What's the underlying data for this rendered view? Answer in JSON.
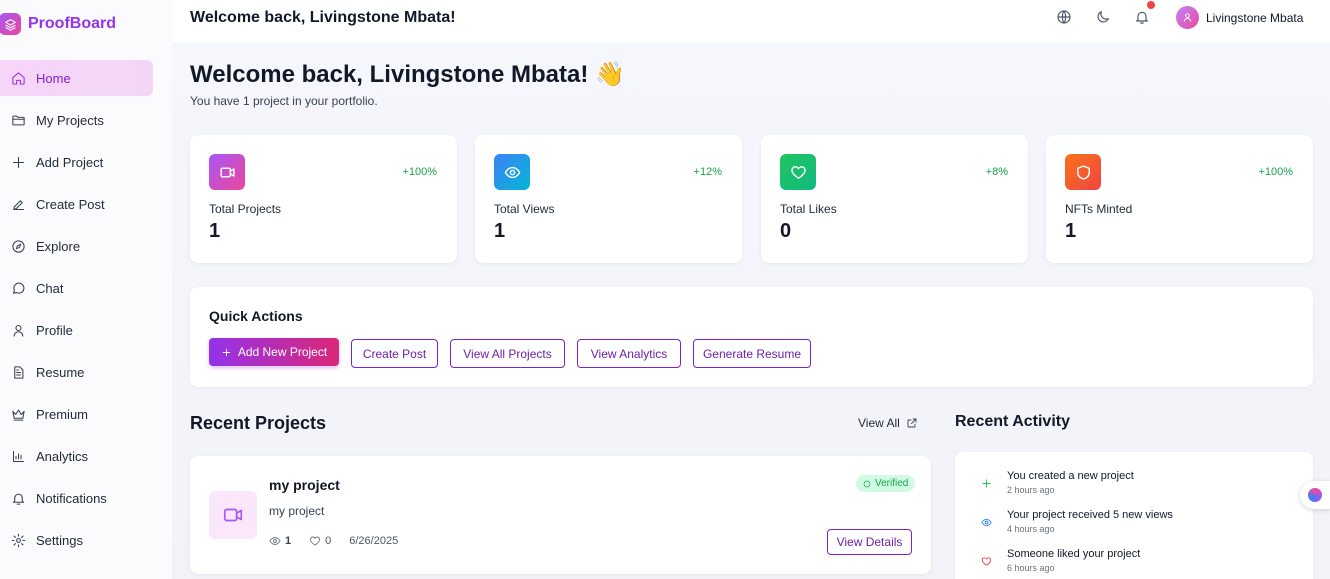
{
  "brand": {
    "name": "ProofBoard"
  },
  "sidebar": {
    "items": [
      {
        "label": "Home",
        "icon": "home-icon",
        "active": true
      },
      {
        "label": "My Projects",
        "icon": "folder-icon"
      },
      {
        "label": "Add Project",
        "icon": "plus-icon"
      },
      {
        "label": "Create Post",
        "icon": "pen-icon"
      },
      {
        "label": "Explore",
        "icon": "compass-icon"
      },
      {
        "label": "Chat",
        "icon": "chat-icon"
      },
      {
        "label": "Profile",
        "icon": "user-icon"
      },
      {
        "label": "Resume",
        "icon": "document-icon"
      },
      {
        "label": "Premium",
        "icon": "crown-icon"
      },
      {
        "label": "Analytics",
        "icon": "bar-chart-icon"
      },
      {
        "label": "Notifications",
        "icon": "bell-icon"
      },
      {
        "label": "Settings",
        "icon": "gear-icon"
      }
    ]
  },
  "topbar": {
    "title": "Welcome back, Livingstone Mbata!",
    "user_name": "Livingstone Mbata"
  },
  "main": {
    "greeting": "Welcome back, Livingstone Mbata! 👋",
    "subtitle": "You have 1 project in your portfolio."
  },
  "stats": [
    {
      "label": "Total Projects",
      "value": "1",
      "change": "+100%",
      "icon": "video-icon",
      "color": "#c026d3"
    },
    {
      "label": "Total Views",
      "value": "1",
      "change": "+12%",
      "icon": "eye-icon",
      "color": "#3b82f6"
    },
    {
      "label": "Total Likes",
      "value": "0",
      "change": "+8%",
      "icon": "heart-icon",
      "color": "#22c55e"
    },
    {
      "label": "NFTs Minted",
      "value": "1",
      "change": "+100%",
      "icon": "shield-icon",
      "color": "#f97316"
    }
  ],
  "quick_actions": {
    "title": "Quick Actions",
    "buttons": [
      "Add New Project",
      "Create Post",
      "View All Projects",
      "View Analytics",
      "Generate Resume"
    ]
  },
  "recent_projects": {
    "title": "Recent Projects",
    "view_all": "View All",
    "items": [
      {
        "title": "my project",
        "description": "my project",
        "views": "1",
        "likes": "0",
        "date": "6/26/2025",
        "badge": "Verified",
        "action": "View Details"
      }
    ]
  },
  "recent_activity": {
    "title": "Recent Activity",
    "items": [
      {
        "text": "You created a new project",
        "time": "2 hours ago",
        "icon": "plus-icon",
        "color": "#22c55e"
      },
      {
        "text": "Your project received 5 new views",
        "time": "4 hours ago",
        "icon": "eye-icon",
        "color": "#3b82f6"
      },
      {
        "text": "Someone liked your project",
        "time": "6 hours ago",
        "icon": "heart-icon",
        "color": "#ef4444"
      }
    ]
  }
}
